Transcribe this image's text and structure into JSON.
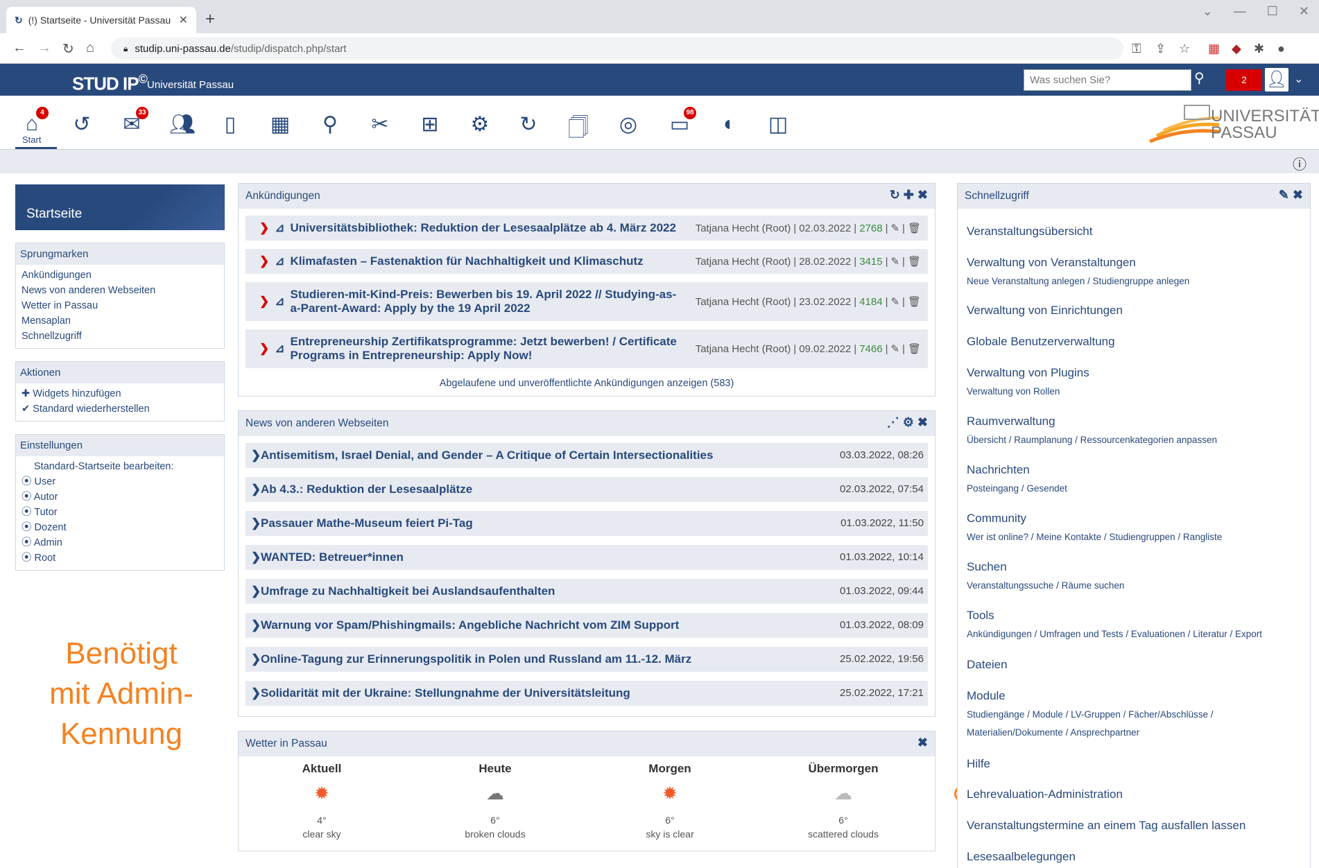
{
  "browser": {
    "tab_title": "(!) Startseite - Universität Passau",
    "url_domain": "studip.uni-passau.de",
    "url_path": "/studip/dispatch.php/start"
  },
  "header": {
    "logo": "STUD IP",
    "logo_sup": "©",
    "university": "Universität Passau",
    "search_placeholder": "Was suchen Sie?",
    "notifications": "2"
  },
  "nav": {
    "start_label": "Start",
    "badges": {
      "home": "4",
      "messages": "33",
      "files": "98"
    },
    "uni_logo_line1": "UNIVERSITÄT",
    "uni_logo_line2": "PASSAU"
  },
  "sidebar": {
    "title": "Startseite",
    "sprungmarken": {
      "heading": "Sprungmarken",
      "items": [
        "Ankündigungen",
        "News von anderen Webseiten",
        "Wetter in Passau",
        "Mensaplan",
        "Schnellzugriff"
      ]
    },
    "aktionen": {
      "heading": "Aktionen",
      "items": [
        "Widgets hinzufügen",
        "Standard wiederherstellen"
      ]
    },
    "einstellungen": {
      "heading": "Einstellungen",
      "subtitle": "Standard-Startseite bearbeiten:",
      "items": [
        "User",
        "Autor",
        "Tutor",
        "Dozent",
        "Admin",
        "Root"
      ]
    }
  },
  "announcements": {
    "title": "Ankündigungen",
    "items": [
      {
        "title": "Universitätsbibliothek: Reduktion der Lesesaalplätze ab 4. März 2022",
        "author": "Tatjana Hecht (Root)",
        "date": "02.03.2022",
        "count": "2768"
      },
      {
        "title": "Klimafasten – Fastenaktion für Nachhaltigkeit und Klimaschutz",
        "author": "Tatjana Hecht (Root)",
        "date": "28.02.2022",
        "count": "3415"
      },
      {
        "title": "Studieren-mit-Kind-Preis: Bewerben bis 19. April 2022 // Studying-as-a-Parent-Award: Apply by the 19 April 2022",
        "author": "Tatjana Hecht (Root)",
        "date": "23.02.2022",
        "count": "4184"
      },
      {
        "title": "Entrepreneurship Zertifikatsprogramme: Jetzt bewerben! / Certificate Programs in Entrepreneurship: Apply Now!",
        "author": "Tatjana Hecht (Root)",
        "date": "09.02.2022",
        "count": "7466"
      }
    ],
    "footer": "Abgelaufene und unveröffentlichte Ankündigungen anzeigen (583)"
  },
  "news": {
    "title": "News von anderen Webseiten",
    "items": [
      {
        "title": "Antisemitism, Israel Denial, and Gender – A Critique of Certain Intersectionalities",
        "date": "03.03.2022, 08:26"
      },
      {
        "title": "Ab 4.3.: Reduktion der Lesesaalplätze",
        "date": "02.03.2022, 07:54"
      },
      {
        "title": "Passauer Mathe-Museum feiert Pi-Tag",
        "date": "01.03.2022, 11:50"
      },
      {
        "title": "WANTED: Betreuer*innen",
        "date": "01.03.2022, 10:14"
      },
      {
        "title": "Umfrage zu Nachhaltigkeit bei Auslandsaufenthalten",
        "date": "01.03.2022, 09:44"
      },
      {
        "title": "Warnung vor Spam/Phishingmails: Angebliche Nachricht vom ZIM Support",
        "date": "01.03.2022, 08:09"
      },
      {
        "title": "Online-Tagung zur Erinnerungspolitik in Polen und Russland am 11.-12. März",
        "date": "25.02.2022, 19:56"
      },
      {
        "title": "Solidarität mit der Ukraine: Stellungnahme der Universitätsleitung",
        "date": "25.02.2022, 17:21"
      }
    ]
  },
  "weather": {
    "title": "Wetter in Passau",
    "cols": [
      {
        "head": "Aktuell",
        "icon": "sun-icon",
        "temp": "4°",
        "desc": "clear sky"
      },
      {
        "head": "Heute",
        "icon": "cloud-icon",
        "temp": "6°",
        "desc": "broken clouds"
      },
      {
        "head": "Morgen",
        "icon": "sun-icon",
        "temp": "6°",
        "desc": "sky is clear"
      },
      {
        "head": "Übermorgen",
        "icon": "cloud-icon",
        "temp": "6°",
        "desc": "scattered clouds"
      }
    ]
  },
  "quickaccess": {
    "title": "Schnellzugriff",
    "items": [
      {
        "label": "Veranstaltungsübersicht",
        "sub": ""
      },
      {
        "label": "Verwaltung von Veranstaltungen",
        "sub": "Neue Veranstaltung anlegen / Studiengruppe anlegen"
      },
      {
        "label": "Verwaltung von Einrichtungen",
        "sub": ""
      },
      {
        "label": "Globale Benutzerverwaltung",
        "sub": ""
      },
      {
        "label": "Verwaltung von Plugins",
        "sub": "Verwaltung von Rollen"
      },
      {
        "label": "Raumverwaltung",
        "sub": "Übersicht / Raumplanung / Ressourcenkategorien anpassen"
      },
      {
        "label": "Nachrichten",
        "sub": "Posteingang / Gesendet"
      },
      {
        "label": "Community",
        "sub": "Wer ist online? / Meine Kontakte / Studiengruppen / Rangliste"
      },
      {
        "label": "Suchen",
        "sub": "Veranstaltungssuche / Räume suchen"
      },
      {
        "label": "Tools",
        "sub": "Ankündigungen / Umfragen und Tests / Evaluationen / Literatur / Export"
      },
      {
        "label": "Dateien",
        "sub": ""
      },
      {
        "label": "Module",
        "sub": "Studiengänge / Module / LV-Gruppen / Fächer/Abschlüsse /"
      },
      {
        "label": "",
        "sub": "Materialien/Dokumente / Ansprechpartner"
      },
      {
        "label": "Hilfe",
        "sub": ""
      },
      {
        "label": "Lehrevaluation-Administration",
        "sub": ""
      },
      {
        "label": "Veranstaltungstermine an einem Tag ausfallen lassen",
        "sub": ""
      },
      {
        "label": "Lesesaalbelegungen",
        "sub": ""
      }
    ]
  },
  "annotation": {
    "text": "Benötigt mit Admin-Kennung",
    "color": "#f58220"
  }
}
